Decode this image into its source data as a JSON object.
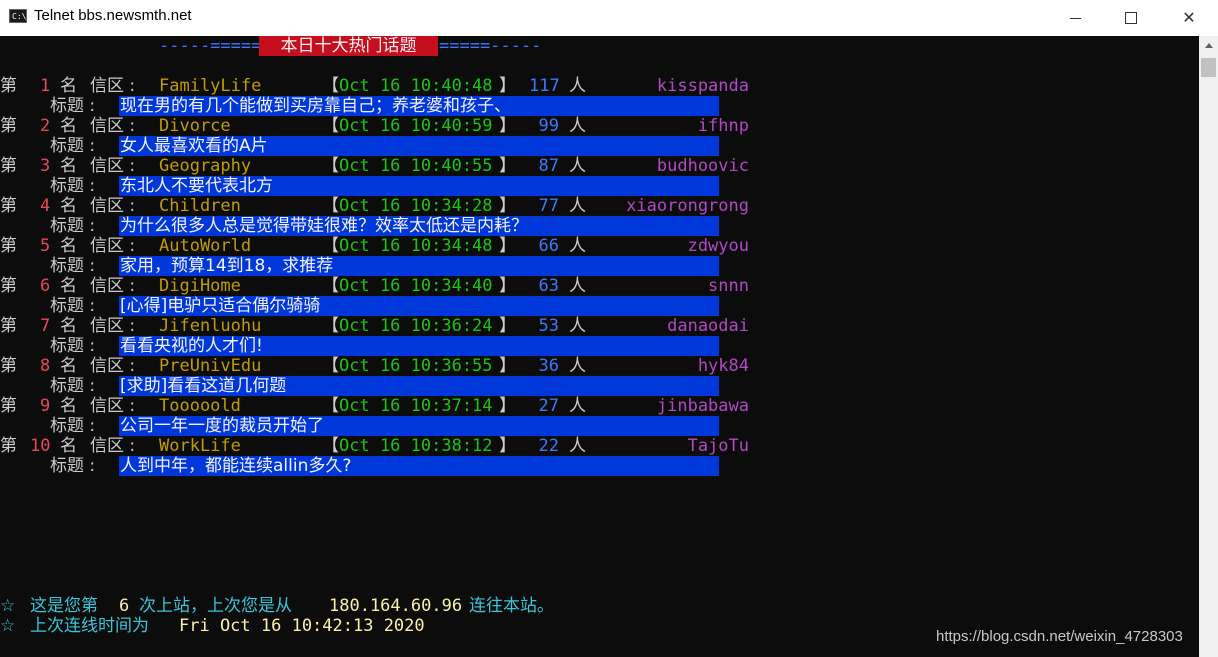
{
  "window": {
    "title": "Telnet bbs.newsmth.net",
    "icon": "cmd-icon",
    "icon_text": "C:\\."
  },
  "banner": {
    "left_decor": "-----=====",
    "title": "本日十大热门话题",
    "right_decor": "=====-----"
  },
  "labels": {
    "rank_prefix": "第",
    "rank_suffix": "名",
    "board_label": "信区 :",
    "subject_label": "标题 :",
    "open_bracket": "【",
    "close_bracket": "】",
    "people_unit": "人"
  },
  "topics": [
    {
      "rank": "1",
      "board": "FamilyLife",
      "time": "Oct 16 10:40:48",
      "count": "117",
      "author": "kisspanda",
      "subject": "现在男的有几个能做到买房靠自己；养老婆和孩子、"
    },
    {
      "rank": "2",
      "board": "Divorce",
      "time": "Oct 16 10:40:59",
      "count": "99",
      "author": "ifhnp",
      "subject": "女人最喜欢看的A片"
    },
    {
      "rank": "3",
      "board": "Geography",
      "time": "Oct 16 10:40:55",
      "count": "87",
      "author": "budhoovic",
      "subject": "东北人不要代表北方"
    },
    {
      "rank": "4",
      "board": "Children",
      "time": "Oct 16 10:34:28",
      "count": "77",
      "author": "xiaorongrong",
      "subject": "为什么很多人总是觉得带娃很难？效率太低还是内耗？"
    },
    {
      "rank": "5",
      "board": "AutoWorld",
      "time": "Oct 16 10:34:48",
      "count": "66",
      "author": "zdwyou",
      "subject": "家用，预算14到18，求推荐"
    },
    {
      "rank": "6",
      "board": "DigiHome",
      "time": "Oct 16 10:34:40",
      "count": "63",
      "author": "snnn",
      "subject": "[心得]电驴只适合偶尔骑骑"
    },
    {
      "rank": "7",
      "board": "Jifenluohu",
      "time": "Oct 16 10:36:24",
      "count": "53",
      "author": "danaodai",
      "subject": "看看央视的人才们!"
    },
    {
      "rank": "8",
      "board": "PreUnivEdu",
      "time": "Oct 16 10:36:55",
      "count": "36",
      "author": "hyk84",
      "subject": "[求助]看看这道几何题"
    },
    {
      "rank": "9",
      "board": "Tooooold",
      "time": "Oct 16 10:37:14",
      "count": "27",
      "author": "jinbabawa",
      "subject": "公司一年一度的裁员开始了"
    },
    {
      "rank": "10",
      "board": "WorkLife",
      "time": "Oct 16 10:38:12",
      "count": "22",
      "author": "TajoTu",
      "subject": "人到中年，都能连续allin多久?"
    }
  ],
  "footer": {
    "star": "☆",
    "line1_a": "这是您第",
    "login_count": "6",
    "line1_b": "次上站，上次您是从",
    "last_ip": "180.164.60.96",
    "line1_c": "连往本站。",
    "line2_a": "上次连线时间为",
    "last_time": "Fri Oct 16 10:42:13 2020"
  },
  "watermark": "https://blog.csdn.net/weixin_4728303",
  "colors": {
    "background": "#0c0c0c",
    "banner_bg": "#c50f1f",
    "subject_bg": "#0037da",
    "rank": "#e74856",
    "board": "#c19c00",
    "time": "#16c60c",
    "count": "#3b78ff",
    "author": "#b148c6",
    "footer": "#3ac6d8"
  }
}
